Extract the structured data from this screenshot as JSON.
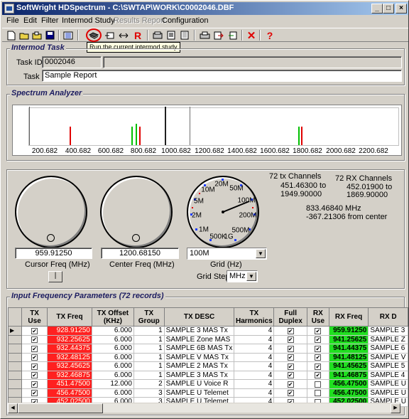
{
  "window": {
    "title": "SoftWright HDSpectrum - C:\\SWTAP\\WORK\\C0002046.DBF",
    "min": "_",
    "max": "□",
    "close": "×"
  },
  "menu": [
    {
      "label": "File",
      "enabled": true
    },
    {
      "label": "Edit",
      "enabled": true
    },
    {
      "label": "Filter",
      "enabled": true
    },
    {
      "label": "Intermod Study",
      "enabled": true
    },
    {
      "label": "Results Report",
      "enabled": false
    },
    {
      "label": "Configuration",
      "enabled": true
    }
  ],
  "tooltip": "Run the current intermod study",
  "intermod_task": {
    "section_title": "Intermod Task",
    "task_id_label": "Task ID:",
    "task_id_value": "0002046",
    "task_label": "Task",
    "task_value": "Sample Report"
  },
  "spectrum": {
    "section_title": "Spectrum Analyzer",
    "ticks": [
      "200.682",
      "400.682",
      "600.682",
      "800.682",
      "1000.682",
      "1200.682",
      "1400.682",
      "1600.682",
      "1800.682",
      "2000.682",
      "2200.682"
    ]
  },
  "controls": {
    "cursor_freq_value": "959.91250",
    "cursor_freq_label": "Cursor Freq (MHz)",
    "center_freq_value": "1200.68150",
    "center_freq_label": "Center Freq (MHz)",
    "grid_value": "100M",
    "grid_label": "Grid (Hz)",
    "grid_step_label": "Grid Step",
    "grid_step_value": "MHz",
    "dial_labels": [
      "20M",
      "50M",
      "10M",
      "100M",
      "5M",
      "200M",
      "2M",
      "500M",
      "1M",
      "500K",
      "1G"
    ],
    "tx_channels": "72 tx Channels",
    "tx_range_from": "451.46300 to",
    "tx_range_to": "1949.90000",
    "rx_channels": "72 RX Channels",
    "rx_range_from": "452.01900 to",
    "rx_range_to": "1869.90000",
    "cursor_mhz": "833.46840 MHz",
    "from_center": "-367.21306 from center"
  },
  "input_params": {
    "section_title": "Input Frequency Parameters (72 records)",
    "columns": [
      "TX Use",
      "TX Freq",
      "TX Offset (KHz)",
      "TX Group",
      "TX DESC",
      "TX Harmonics",
      "Full Duplex",
      "RX Use",
      "RX Freq",
      "RX D"
    ],
    "rows": [
      {
        "tx_use": true,
        "tx_freq": "928.91250",
        "offset": "6.000",
        "group": "1",
        "desc": "SAMPLE 3 MAS Tx",
        "harm": "4",
        "duplex": true,
        "rx_use": true,
        "rx_freq": "959.91250",
        "rx_desc": "SAMPLE 3"
      },
      {
        "tx_use": true,
        "tx_freq": "932.25625",
        "offset": "6.000",
        "group": "1",
        "desc": "SAMPLE Zone MAS",
        "harm": "4",
        "duplex": true,
        "rx_use": true,
        "rx_freq": "941.25625",
        "rx_desc": "SAMPLE Z"
      },
      {
        "tx_use": true,
        "tx_freq": "932.44375",
        "offset": "6.000",
        "group": "1",
        "desc": "SAMPLE 6B MAS Tx",
        "harm": "4",
        "duplex": true,
        "rx_use": true,
        "rx_freq": "941.44375",
        "rx_desc": "SAMPLE 6"
      },
      {
        "tx_use": true,
        "tx_freq": "932.48125",
        "offset": "6.000",
        "group": "1",
        "desc": "SAMPLE V MAS Tx",
        "harm": "4",
        "duplex": true,
        "rx_use": true,
        "rx_freq": "941.48125",
        "rx_desc": "SAMPLE V"
      },
      {
        "tx_use": true,
        "tx_freq": "932.45625",
        "offset": "6.000",
        "group": "1",
        "desc": "SAMPLE 2 MAS Tx",
        "harm": "4",
        "duplex": true,
        "rx_use": true,
        "rx_freq": "941.45625",
        "rx_desc": "SAMPLE 5"
      },
      {
        "tx_use": true,
        "tx_freq": "932.46875",
        "offset": "6.000",
        "group": "1",
        "desc": "SAMPLE 3 MAS Tx",
        "harm": "4",
        "duplex": true,
        "rx_use": true,
        "rx_freq": "941.46875",
        "rx_desc": "SAMPLE 4"
      },
      {
        "tx_use": true,
        "tx_freq": "451.47500",
        "offset": "12.000",
        "group": "2",
        "desc": "SAMPLE U  Voice R",
        "harm": "4",
        "duplex": true,
        "rx_use": false,
        "rx_freq": "456.47500",
        "rx_desc": "SAMPLE U"
      },
      {
        "tx_use": true,
        "tx_freq": "456.47500",
        "offset": "6.000",
        "group": "3",
        "desc": "SAMPLE U  Telemet",
        "harm": "4",
        "duplex": true,
        "rx_use": false,
        "rx_freq": "456.47500",
        "rx_desc": "SAMPLE U"
      },
      {
        "tx_use": true,
        "tx_freq": "452.02500",
        "offset": "6.000",
        "group": "3",
        "desc": "SAMPLE U  Telemet",
        "harm": "4",
        "duplex": true,
        "rx_use": false,
        "rx_freq": "452.02500",
        "rx_desc": "SAMPLE U"
      }
    ]
  },
  "colors": {
    "tx_freq_bg": "#ff2020",
    "rx_freq_bg": "#20e020",
    "title_start": "#0a246a",
    "title_end": "#a6caf0",
    "accent_text": "#1c1c60"
  }
}
